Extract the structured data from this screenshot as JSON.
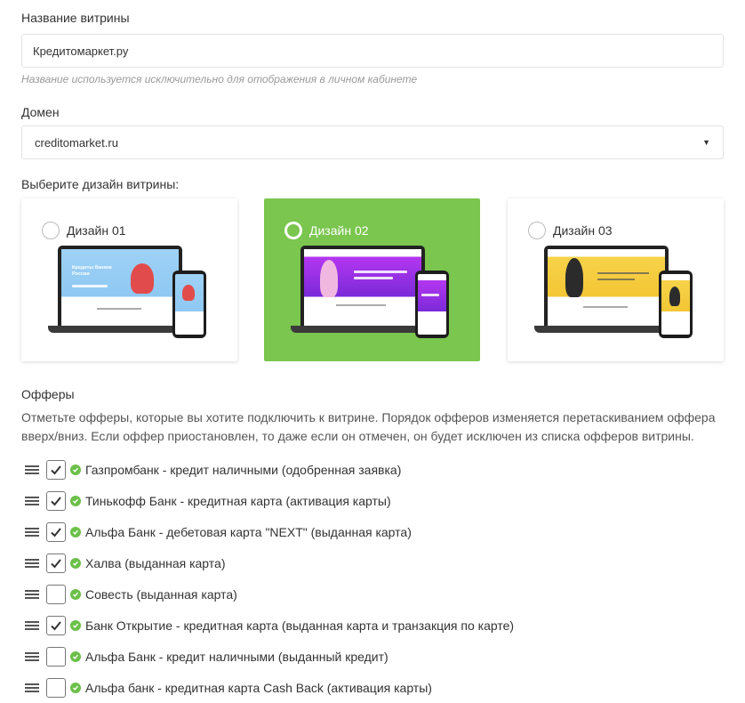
{
  "showcase_name": {
    "label": "Название витрины",
    "value": "Кредитомаркет.ру",
    "hint": "Название используется исключительно для отображения в личном кабинете"
  },
  "domain": {
    "label": "Домен",
    "selected": "creditomarket.ru"
  },
  "design": {
    "label": "Выберите дизайн витрины:",
    "options": [
      {
        "title": "Дизайн 01",
        "selected": false
      },
      {
        "title": "Дизайн 02",
        "selected": true
      },
      {
        "title": "Дизайн 03",
        "selected": false
      }
    ],
    "preview_texts": [
      "Кредиты банков России"
    ]
  },
  "offers": {
    "title": "Офферы",
    "description": "Отметьте офферы, которые вы хотите подключить к витрине. Порядок офферов изменяется перетаскиванием оффера вверх/вниз. Если оффер приостановлен, то даже если он отмечен, он будет исключен из списка офферов витрины.",
    "items": [
      {
        "label": "Газпромбанк - кредит наличными (одобренная заявка)",
        "checked": true
      },
      {
        "label": "Тинькофф Банк - кредитная карта (активация карты)",
        "checked": true
      },
      {
        "label": "Альфа Банк - дебетовая карта \"NEXT\" (выданная карта)",
        "checked": true
      },
      {
        "label": "Халва (выданная карта)",
        "checked": true
      },
      {
        "label": "Совесть (выданная карта)",
        "checked": false
      },
      {
        "label": "Банк Открытие - кредитная карта (выданная карта и транзакция по карте)",
        "checked": true
      },
      {
        "label": "Альфа Банк - кредит наличными (выданный кредит)",
        "checked": false
      },
      {
        "label": "Альфа банк - кредитная карта Cash Back (активация карты)",
        "checked": false
      }
    ]
  },
  "colors": {
    "selected_design_bg": "#7ac64e",
    "status_active": "#6cc04a"
  }
}
